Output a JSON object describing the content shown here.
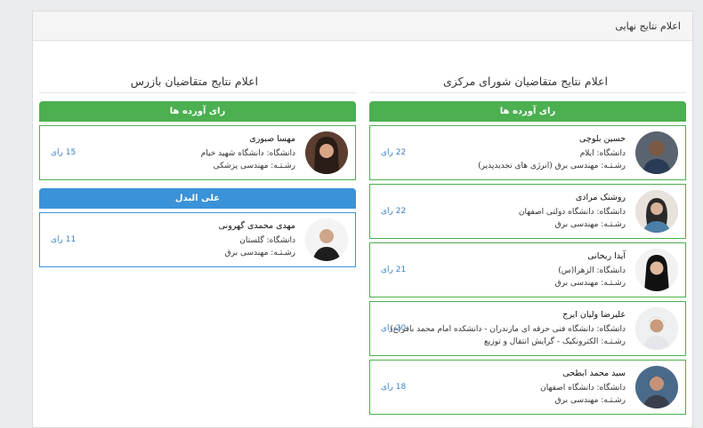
{
  "panel": {
    "title": "اعلام نتایج نهایی"
  },
  "central": {
    "title": "اعلام نتایج متقاضیان شورای مرکزی",
    "section_label": "رای آورده ها",
    "candidates": [
      {
        "name": "حسین بلوچی",
        "university": "دانشگاه: ایلام",
        "major": "رشـتـه: مهندسی برق (انرژی های تجدیدپذیر)",
        "votes": "22 رای"
      },
      {
        "name": "روشنک مرادی",
        "university": "دانشگاه: دانشگاه دولتی اصفهان",
        "major": "رشـتـه: مهندسی برق",
        "votes": "22 رای"
      },
      {
        "name": "آیدا ریحانی",
        "university": "دانشگاه: الزهرا(س)",
        "major": "رشـتـه: مهندسی برق",
        "votes": "21 رای"
      },
      {
        "name": "علیرضا ولیان ایرج",
        "university": "دانشگاه: دانشگاه فنی حرفه ای مازندران - دانشکده امام محمد باقر(ع)",
        "major": "رشـتـه: الکترونکیک - گرایش انتقال و توزیع",
        "votes": "20 رای"
      },
      {
        "name": "سید محمد ابطحی",
        "university": "دانشگاه: دانشگاه اصفهان",
        "major": "رشـتـه: مهندسی برق",
        "votes": "18 رای"
      }
    ]
  },
  "inspector": {
    "title": "اعلام نتایج متقاضیان بازرس",
    "section_label": "رای آورده ها",
    "alternate_label": "علی البدل",
    "winner": {
      "name": "مهسا صبوری",
      "university": "دانشگاه: دانشگاه شهید خیام",
      "major": "رشـتـه: مهندسی پزشکی",
      "votes": "15 رای"
    },
    "alternate": {
      "name": "مهدی محمدی گهرونی",
      "university": "دانشگاه: گلستان",
      "major": "رشـتـه: مهندسی برق",
      "votes": "11 رای"
    }
  },
  "colors": {
    "green": "#4caf50",
    "blue": "#3a92d8",
    "vote_text": "#3a7fc4"
  }
}
